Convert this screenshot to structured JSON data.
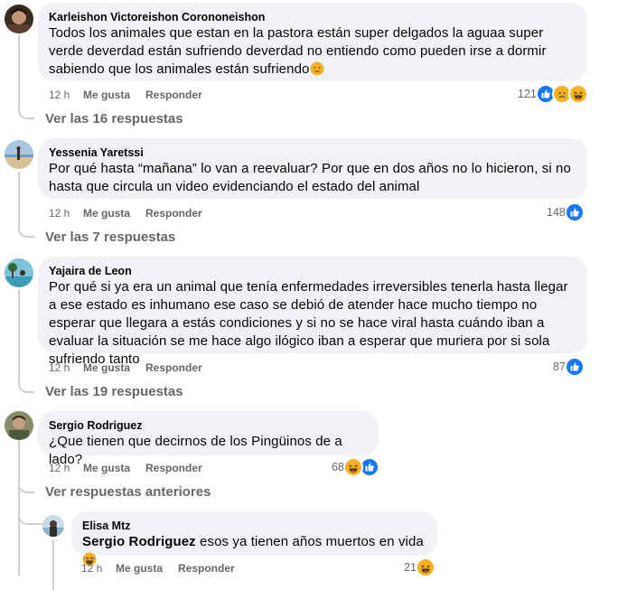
{
  "comments": [
    {
      "author": "Karleishon Victoreishon Corononeishon",
      "text": "Todos los animales que estan en la pastora están super delgados la aguaa super verde deverdad están sufriendo deverdad no entiendo como pueden irse a dormir sabiendo que los animales están sufriendo",
      "time": "12 h",
      "like_label": "Me gusta",
      "reply_label": "Responder",
      "reaction_count": "121",
      "replies_link": "Ver las 16 respuestas"
    },
    {
      "author": "Yessenia Yaretssi",
      "text": "Por qué hasta “mañana” lo van a reevaluar? Por que en dos años no lo hicieron, si no hasta que circula un video evidenciando el estado del animal",
      "time": "12 h",
      "like_label": "Me gusta",
      "reply_label": "Responder",
      "reaction_count": "148",
      "replies_link": "Ver las 7 respuestas"
    },
    {
      "author": "Yajaira de Leon",
      "text": "Por qué si ya era un animal que tenía enfermedades irreversibles tenerla hasta llegar a ese estado es inhumano ese caso se debió de atender hace mucho tiempo no esperar que llegara a estás condiciones y si no se hace viral hasta cuándo iban a evaluar la situación se me hace algo ilógico iban a esperar que muriera por si sola sufriendo tanto",
      "time": "12 h",
      "like_label": "Me gusta",
      "reply_label": "Responder",
      "reaction_count": "87",
      "replies_link": "Ver las 19 respuestas"
    },
    {
      "author": "Sergio Rodriguez",
      "text": "¿Que tienen que decirnos de los Pingüinos de a lado?",
      "time": "12 h",
      "like_label": "Me gusta",
      "reply_label": "Responder",
      "reaction_count": "68",
      "replies_link": "Ver respuestas anteriores"
    }
  ],
  "reply": {
    "author": "Elisa Mtz",
    "mention": "Sergio Rodriguez",
    "text": " esos ya tienen años muertos en vida",
    "time": "12 h",
    "like_label": "Me gusta",
    "reply_label": "Responder",
    "reaction_count": "21"
  },
  "colors": {
    "like_blue": "#1877f2",
    "reaction_yellow": "#f7b125",
    "meta_gray": "#65676b",
    "bubble_bg": "#f0f2f5",
    "thread_line": "#ced0d4"
  },
  "icons": [
    "like-icon",
    "sad-icon",
    "haha-icon",
    "sad-face-emoji",
    "laughing-emoji"
  ]
}
